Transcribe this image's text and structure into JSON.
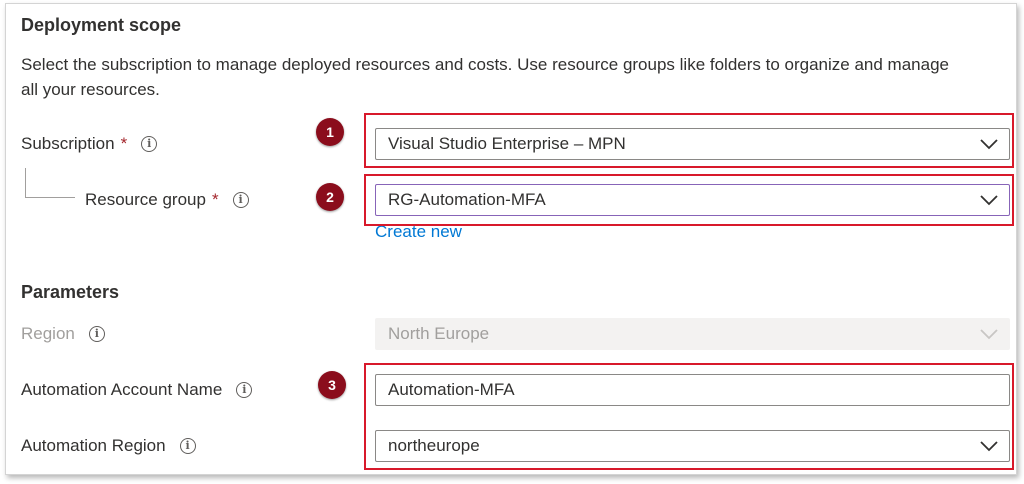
{
  "deployment_scope": {
    "title": "Deployment scope",
    "description": "Select the subscription to manage deployed resources and costs. Use resource groups like folders to organize and manage all your resources.",
    "subscription": {
      "label": "Subscription",
      "required_mark": "*",
      "value": "Visual Studio Enterprise – MPN"
    },
    "resource_group": {
      "label": "Resource group",
      "required_mark": "*",
      "value": "RG-Automation-MFA",
      "create_new": "Create new"
    }
  },
  "parameters": {
    "title": "Parameters",
    "region": {
      "label": "Region",
      "value": "North Europe",
      "disabled": true
    },
    "automation_account_name": {
      "label": "Automation Account Name",
      "value": "Automation-MFA"
    },
    "automation_region": {
      "label": "Automation Region",
      "value": "northeurope"
    }
  },
  "annotations": {
    "badge_1": "1",
    "badge_2": "2",
    "badge_3": "3",
    "highlight_color": "#d8192b",
    "badge_color": "#8b0d1c"
  },
  "icons": {
    "info": "info-icon",
    "dropdown": "chevron-down-icon"
  },
  "colors": {
    "link": "#0078d4",
    "required": "#a4262c",
    "text": "#323130",
    "disabled_text": "#a19f9d"
  }
}
